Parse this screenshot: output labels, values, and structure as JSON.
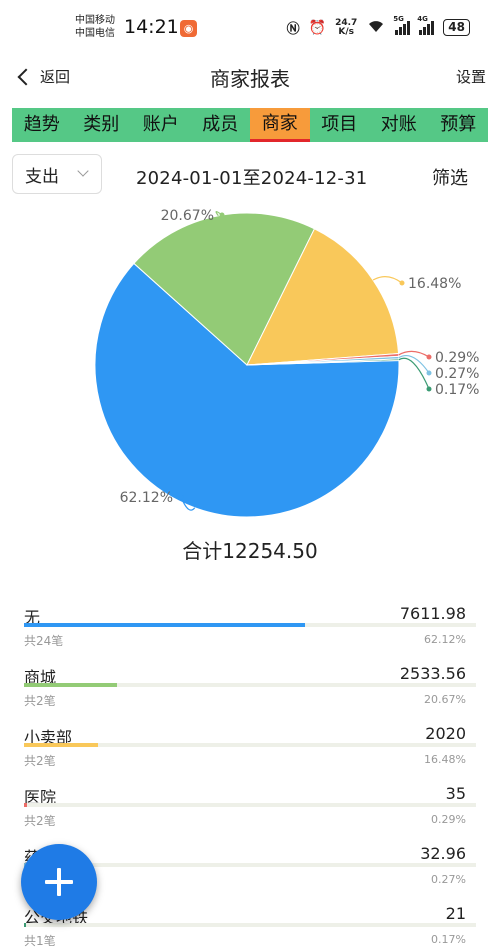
{
  "status_bar": {
    "carrier_1": "中国移动",
    "carrier_2": "中国电信",
    "time": "14:21",
    "net_speed_value": "24.7",
    "net_speed_unit": "K/s",
    "signal_1_label": "5G",
    "signal_2_label": "4G",
    "battery": "48"
  },
  "navbar": {
    "back_label": "返回",
    "title": "商家报表",
    "settings_label": "设置"
  },
  "tabs": [
    {
      "label": "趋势",
      "active": false
    },
    {
      "label": "类别",
      "active": false
    },
    {
      "label": "账户",
      "active": false
    },
    {
      "label": "成员",
      "active": false
    },
    {
      "label": "商家",
      "active": true
    },
    {
      "label": "项目",
      "active": false
    },
    {
      "label": "对账",
      "active": false
    },
    {
      "label": "预算",
      "active": false
    }
  ],
  "filter": {
    "type_value": "支出",
    "date_range": "2024-01-01至2024-12-31",
    "filter_label": "筛选"
  },
  "chart_data": {
    "type": "pie",
    "slices": [
      {
        "label": "无",
        "percent": 62.12,
        "percent_label": "62.12%",
        "color": "#2f97f3"
      },
      {
        "label": "商城",
        "percent": 20.67,
        "percent_label": "20.67%",
        "color": "#93cb76"
      },
      {
        "label": "小卖部",
        "percent": 16.48,
        "percent_label": "16.48%",
        "color": "#f9c85a"
      },
      {
        "label": "医院",
        "percent": 0.29,
        "percent_label": "0.29%",
        "color": "#ec6d68"
      },
      {
        "label": "药店",
        "percent": 0.27,
        "percent_label": "0.27%",
        "color": "#7ec2e3"
      },
      {
        "label": "公交地铁",
        "percent": 0.17,
        "percent_label": "0.17%",
        "color": "#3b9b73"
      }
    ]
  },
  "total_label": "合计12254.50",
  "merchants": [
    {
      "name": "无",
      "amount": "7611.98",
      "count": "共24笔",
      "percent": "62.12%",
      "ratio": 0.6212,
      "color": "#2f97f3"
    },
    {
      "name": "商城",
      "amount": "2533.56",
      "count": "共2笔",
      "percent": "20.67%",
      "ratio": 0.2067,
      "color": "#93cb76"
    },
    {
      "name": "小卖部",
      "amount": "2020",
      "count": "共2笔",
      "percent": "16.48%",
      "ratio": 0.1648,
      "color": "#f9c85a"
    },
    {
      "name": "医院",
      "amount": "35",
      "count": "共2笔",
      "percent": "0.29%",
      "ratio": 0.0029,
      "color": "#ec6d68"
    },
    {
      "name": "药店",
      "amount": "32.96",
      "count": "",
      "percent": "0.27%",
      "ratio": 0.0027,
      "color": "#7ec2e3"
    },
    {
      "name": "公交地铁",
      "amount": "21",
      "count": "共1笔",
      "percent": "0.17%",
      "ratio": 0.0017,
      "color": "#3b9b73"
    }
  ],
  "fab": {
    "icon": "plus-icon"
  }
}
